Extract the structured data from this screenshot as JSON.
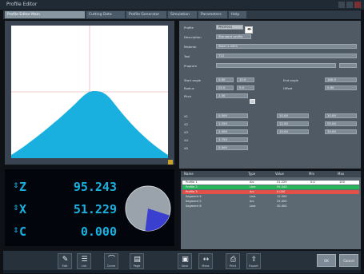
{
  "window": {
    "title": "Profile Editor"
  },
  "tabs": [
    "Profile Editor Main",
    "Cutting Data",
    "Profile Generator",
    "Simulation",
    "Parameters",
    "Help"
  ],
  "graph": {
    "fill_color": "#19b0e0",
    "grid_color": "#e7a0a0",
    "peak_label": ""
  },
  "readout": {
    "axes": [
      {
        "label": "Z",
        "value": "95.243"
      },
      {
        "label": "X",
        "value": "51.229"
      },
      {
        "label": "C",
        "value": "0.000"
      }
    ],
    "gauge": {
      "fraction": 0.22,
      "fill": "#3a3fd0",
      "base": "#9aa3ab"
    }
  },
  "panel": {
    "profile_label": "Profile",
    "profile_value": "PROF001",
    "rows": [
      {
        "label": "Description",
        "value": "Standard profile"
      },
      {
        "label": "Material",
        "value": "Steel 1.4301"
      },
      {
        "label": "Tool",
        "value": "T12"
      },
      {
        "label": "Program",
        "value": ""
      }
    ],
    "param_rows": [
      {
        "label": "Start angle",
        "a": "0.00",
        "b": "10.0",
        "c_label": "End angle",
        "c": "180.0"
      },
      {
        "label": "Radius",
        "a": "25.0",
        "b": "5.0",
        "c_label": "Offset",
        "c": "0.00"
      },
      {
        "label": "Pitch",
        "a": "1.50",
        "b": "",
        "c_label": "",
        "c": ""
      }
    ],
    "grid": [
      [
        "0.000",
        "10.00",
        "20.00"
      ],
      [
        "1.250",
        "12.50",
        "25.00"
      ],
      [
        "2.500",
        "15.00",
        "30.00"
      ],
      [
        "3.750",
        "",
        ""
      ],
      [
        "5.000",
        "",
        ""
      ]
    ],
    "grid_labels": [
      "X1",
      "X2",
      "X3",
      "X4",
      "X5"
    ]
  },
  "table": {
    "header": [
      "Name",
      "Type",
      "Value",
      "Min",
      "Max"
    ],
    "rows": [
      {
        "style": "white",
        "cells": [
          "Profile 1",
          "Arc",
          "51.229",
          "0.0",
          "100"
        ]
      },
      {
        "style": "green",
        "cells": [
          "Profile 2",
          "Line",
          "95.243",
          "",
          ""
        ]
      },
      {
        "style": "red",
        "cells": [
          "Profile 3",
          "Arc",
          "0.000",
          "",
          ""
        ]
      },
      {
        "style": "",
        "cells": [
          "Segment 4",
          "Line",
          "12.500",
          "",
          ""
        ]
      },
      {
        "style": "",
        "cells": [
          "Segment 5",
          "Arc",
          "25.000",
          "",
          ""
        ]
      },
      {
        "style": "",
        "cells": [
          "Segment 6",
          "Line",
          "30.000",
          "",
          ""
        ]
      }
    ]
  },
  "bottom": {
    "tools": [
      {
        "icon": "cursor-icon",
        "glyph": "✎",
        "caption": "Edit"
      },
      {
        "icon": "list-icon",
        "glyph": "☰",
        "caption": "List"
      },
      {
        "icon": "chart-icon",
        "glyph": "⌒",
        "caption": "Curve"
      },
      {
        "icon": "page-icon",
        "glyph": "▤",
        "caption": "Page"
      },
      {
        "icon": "save-icon",
        "glyph": "▣",
        "caption": "Save"
      },
      {
        "icon": "measure-icon",
        "glyph": "↔",
        "caption": "Meas"
      },
      {
        "icon": "print-icon",
        "glyph": "⎙",
        "caption": "Print"
      },
      {
        "icon": "export-icon",
        "glyph": "⇪",
        "caption": "Export"
      }
    ],
    "buttons": [
      "OK",
      "Cancel"
    ]
  }
}
